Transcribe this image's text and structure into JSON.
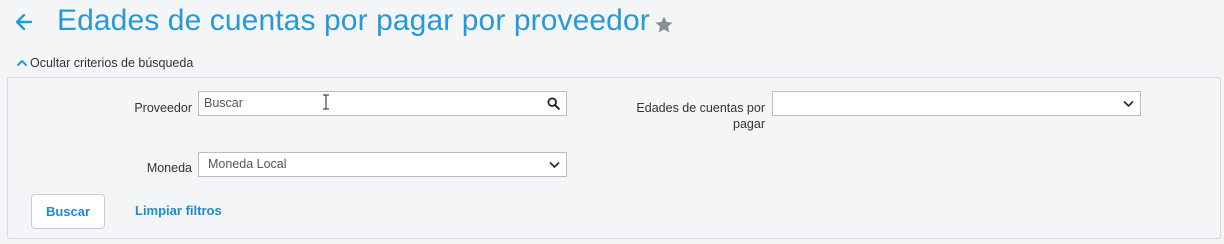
{
  "header": {
    "title": "Edades de cuentas por pagar por proveedor",
    "back_icon": "arrow-left-icon",
    "favorite_icon": "star-icon"
  },
  "criteria_toggle": {
    "label": "Ocultar criterios de búsqueda",
    "icon": "chevron-up-icon"
  },
  "filters": {
    "proveedor": {
      "label": "Proveedor",
      "value": "Buscar",
      "icon": "search-icon"
    },
    "edades": {
      "label_line1": "Edades de cuentas por",
      "label_line2": "pagar",
      "value": ""
    },
    "moneda": {
      "label": "Moneda",
      "value": "Moneda Local"
    }
  },
  "actions": {
    "search_label": "Buscar",
    "clear_label": "Limpiar filtros"
  },
  "colors": {
    "accent": "#2699d8",
    "link": "#2189cd",
    "background": "#f4f5f6"
  }
}
